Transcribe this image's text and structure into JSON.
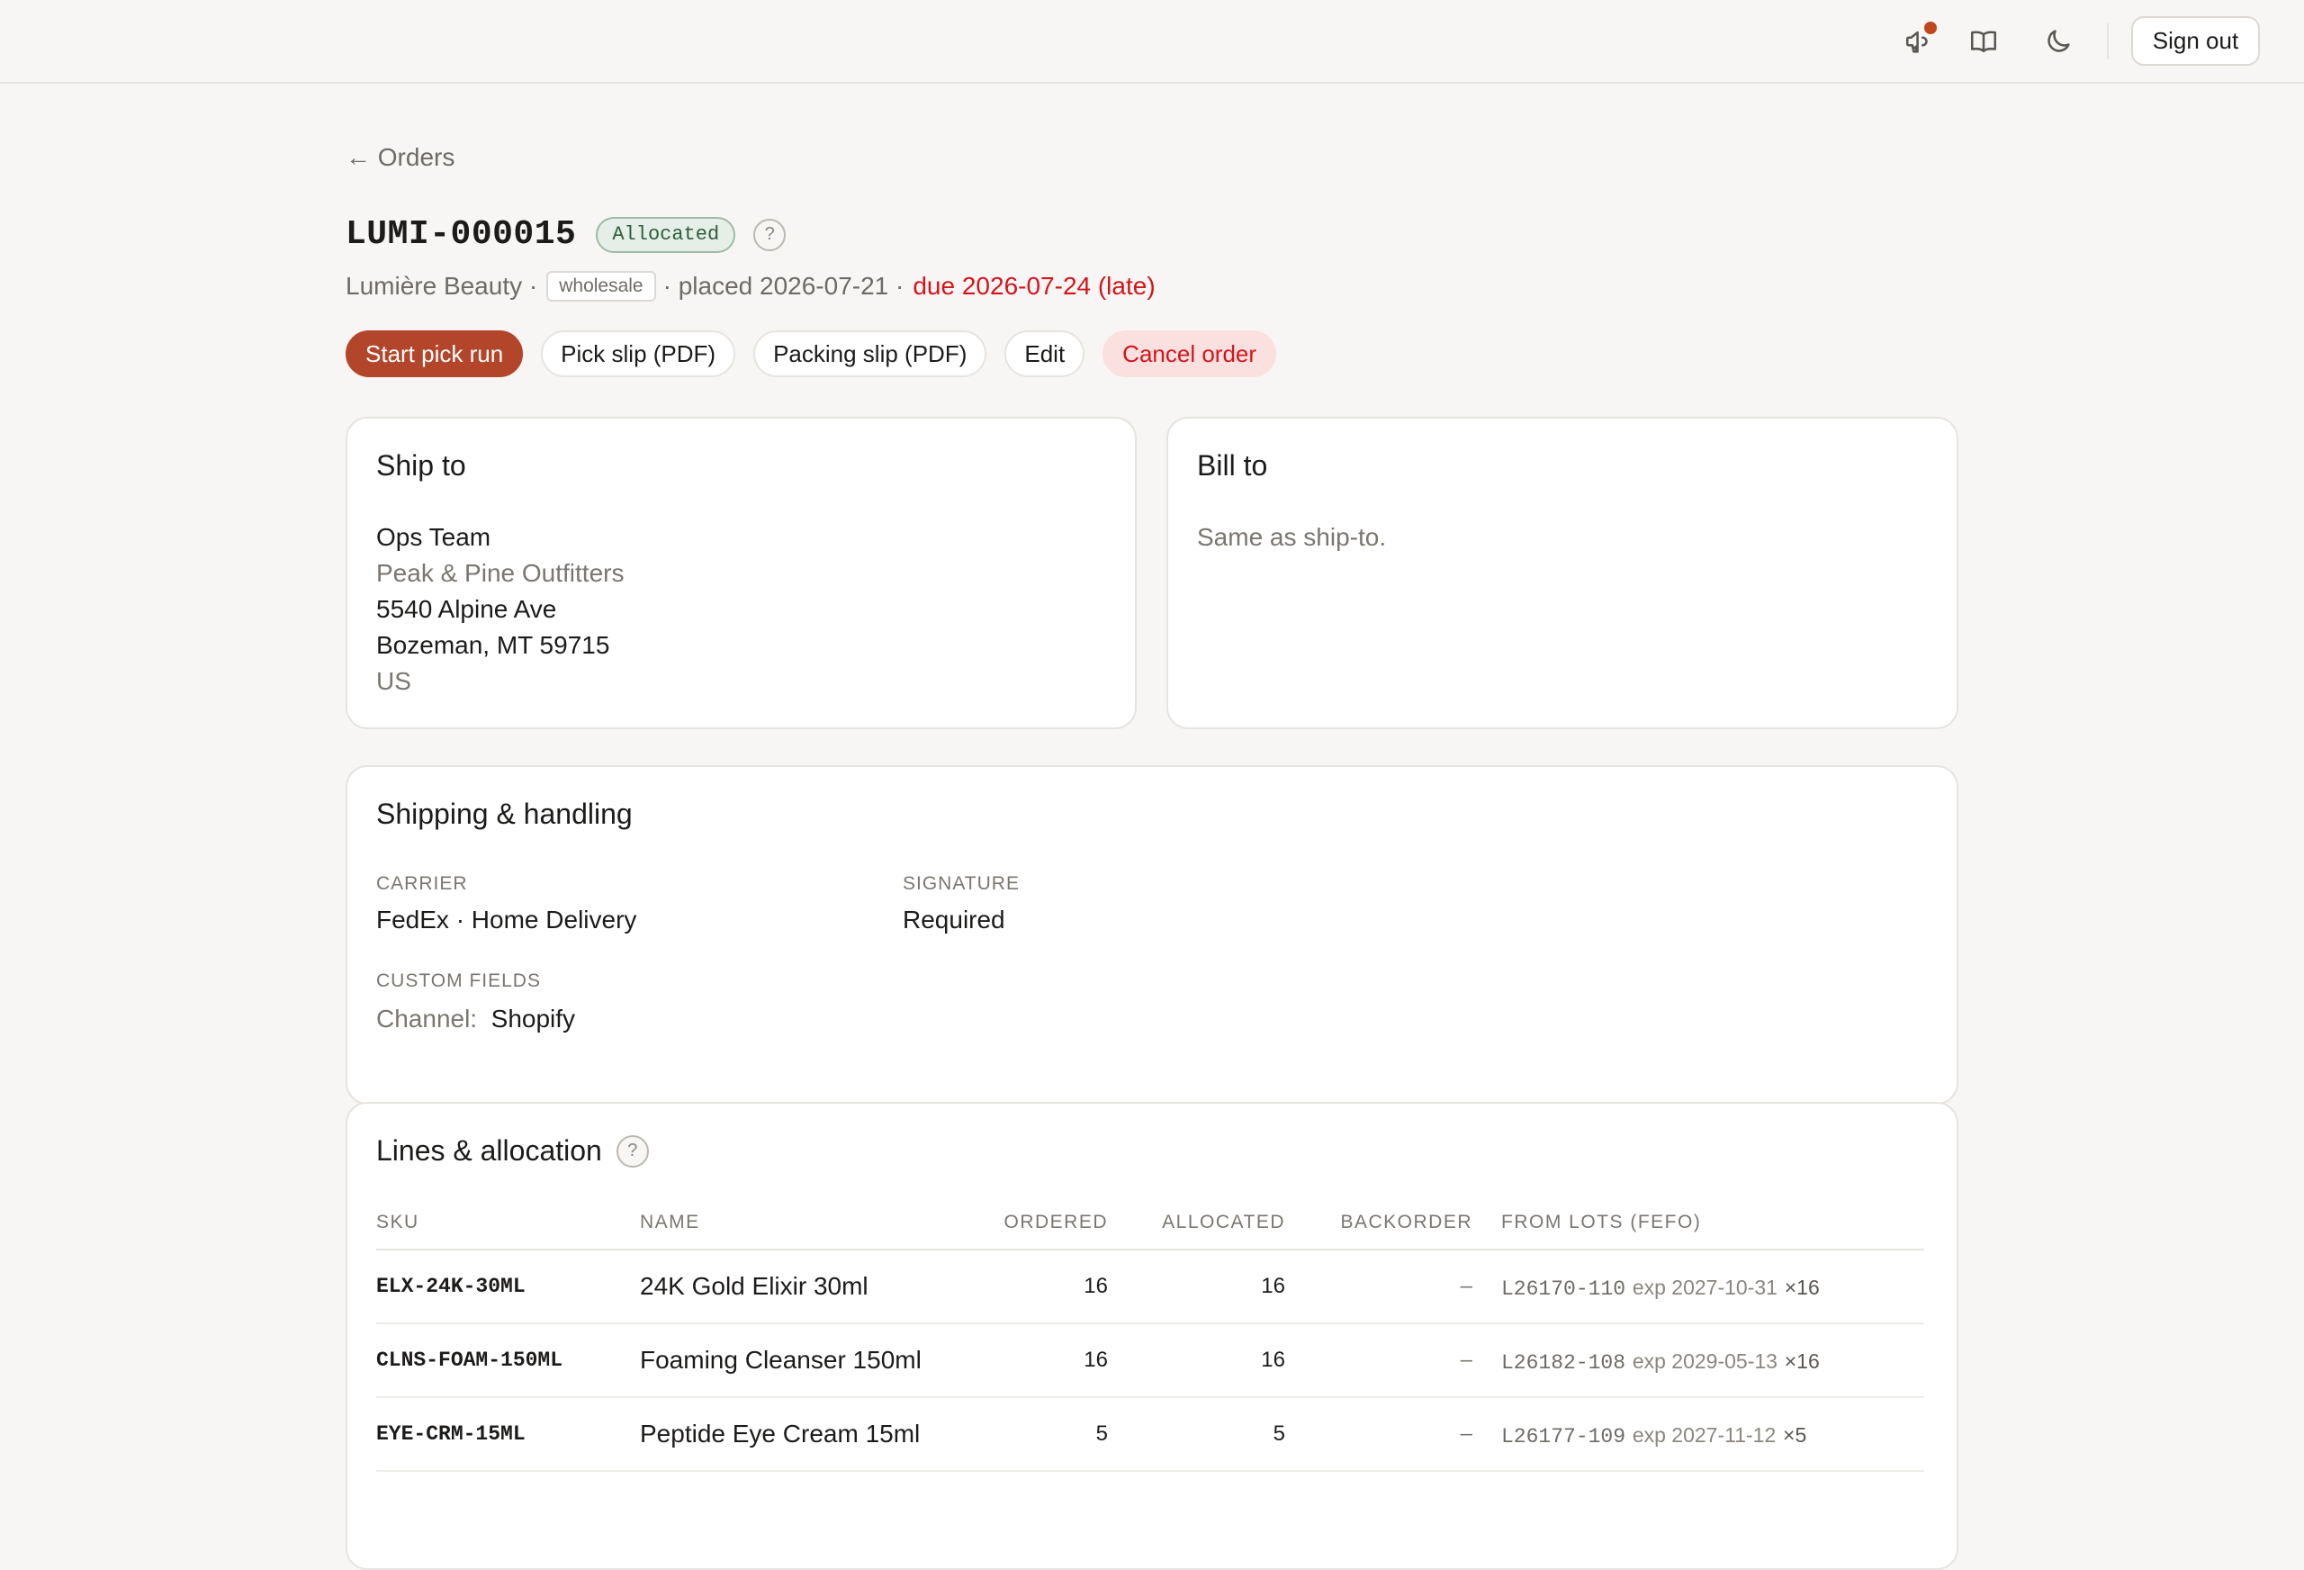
{
  "topbar": {
    "signout_label": "Sign out"
  },
  "nav": {
    "back_label": "← Orders"
  },
  "order": {
    "id": "LUMI-000015",
    "status": "Allocated",
    "help": "?",
    "customer": "Lumière Beauty ·",
    "channel_tag": "wholesale",
    "placed": "· placed 2026-07-21 ·",
    "due": "due 2026-07-24 (late)"
  },
  "actions": {
    "start_pick": "Start pick run",
    "pick_slip": "Pick slip (PDF)",
    "packing_slip": "Packing slip (PDF)",
    "edit": "Edit",
    "cancel": "Cancel order"
  },
  "ship_to": {
    "title": "Ship to",
    "name": "Ops Team",
    "company": "Peak & Pine Outfitters",
    "street": "5540 Alpine Ave",
    "city_line": "Bozeman, MT 59715",
    "country": "US"
  },
  "bill_to": {
    "title": "Bill to",
    "note": "Same as ship-to."
  },
  "shipping": {
    "title": "Shipping & handling",
    "carrier_label": "CARRIER",
    "carrier_value": "FedEx · Home Delivery",
    "signature_label": "SIGNATURE",
    "signature_value": "Required",
    "custom_label": "CUSTOM FIELDS",
    "custom_key": "Channel:",
    "custom_value": "Shopify"
  },
  "lines": {
    "title": "Lines & allocation",
    "help": "?",
    "headers": [
      "SKU",
      "NAME",
      "ORDERED",
      "ALLOCATED",
      "BACKORDER",
      "FROM LOTS (FEFO)"
    ],
    "rows": [
      {
        "sku": "ELX-24K-30ML",
        "name": "24K Gold Elixir 30ml",
        "ordered": "16",
        "allocated": "16",
        "backorder": "–",
        "lot": "L26170-110",
        "exp": "exp 2027-10-31",
        "qty": "×16"
      },
      {
        "sku": "CLNS-FOAM-150ML",
        "name": "Foaming Cleanser 150ml",
        "ordered": "16",
        "allocated": "16",
        "backorder": "–",
        "lot": "L26182-108",
        "exp": "exp 2029-05-13",
        "qty": "×16"
      },
      {
        "sku": "EYE-CRM-15ML",
        "name": "Peptide Eye Cream 15ml",
        "ordered": "5",
        "allocated": "5",
        "backorder": "–",
        "lot": "L26177-109",
        "exp": "exp 2027-11-12",
        "qty": "×5"
      }
    ]
  },
  "colors": {
    "accent": "#b3462a",
    "danger": "#d4141c",
    "status_green": "#2f5d3c",
    "notification_dot": "#c2461f"
  },
  "icons": [
    "megaphone-icon",
    "book-icon",
    "moon-icon"
  ]
}
